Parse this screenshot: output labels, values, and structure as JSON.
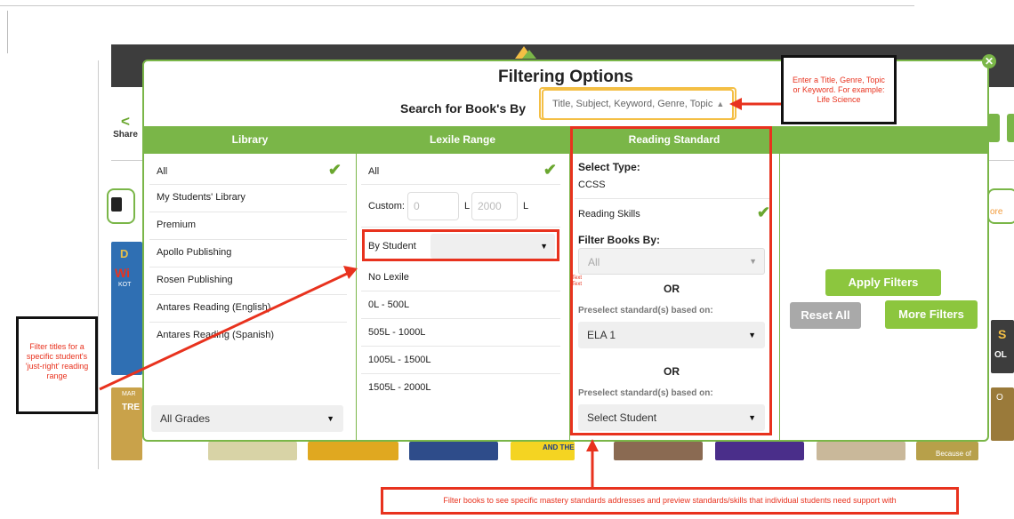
{
  "background": {
    "share_label": "Share",
    "share_icon": "share-icon",
    "right_partial": "ore",
    "book_cover_texts": [
      "D",
      "Wi",
      "KOT",
      "MAR",
      "TRE",
      "AND THE",
      "Because of",
      "O",
      "S",
      "OL"
    ]
  },
  "modal": {
    "title": "Filtering Options",
    "search_label": "Search for Book's By",
    "search_placeholder": "Title, Subject, Keyword, Genre, Topic",
    "close_icon": "close-icon"
  },
  "columns": {
    "library": "Library",
    "lexile": "Lexile Range",
    "standard": "Reading Standard"
  },
  "library": {
    "items": [
      "All",
      "My Students' Library",
      "Premium",
      "Apollo Publishing",
      "Rosen Publishing",
      "Antares Reading (English)",
      "Antares Reading (Spanish)"
    ],
    "grades": "All Grades"
  },
  "lexile": {
    "all": "All",
    "custom_label": "Custom:",
    "custom_min": "0",
    "custom_max": "2000",
    "unit": "L",
    "by_student": "By Student",
    "ranges": [
      "No Lexile",
      "0L - 500L",
      "505L - 1000L",
      "1005L - 1500L",
      "1505L - 2000L"
    ]
  },
  "standard": {
    "select_type": "Select Type:",
    "type_value": "CCSS",
    "reading_skills": "Reading Skills",
    "filter_by": "Filter Books By:",
    "filter_value": "All",
    "or1": "OR",
    "preselect1": "Preselect standard(s) based on:",
    "ela": "ELA 1",
    "or2": "OR",
    "preselect2": "Preselect standard(s) based on:",
    "select_student": "Select Student",
    "stray_text": "Text"
  },
  "actions": {
    "apply": "Apply Filters",
    "reset": "Reset All",
    "more": "More Filters"
  },
  "annotations": {
    "search_note": "Enter a Title, Genre, Topic or Keyword. For example: Life Science",
    "student_note": "Filter titles for a specific student's 'just-right' reading range",
    "standards_note": "Filter books to see specific mastery standards addresses and preview standards/skills that individual students need support with"
  },
  "colors": {
    "green": "#7ab648",
    "red": "#e8321e",
    "yellow": "#f4bf45",
    "gray_button": "#a9a9a9"
  }
}
